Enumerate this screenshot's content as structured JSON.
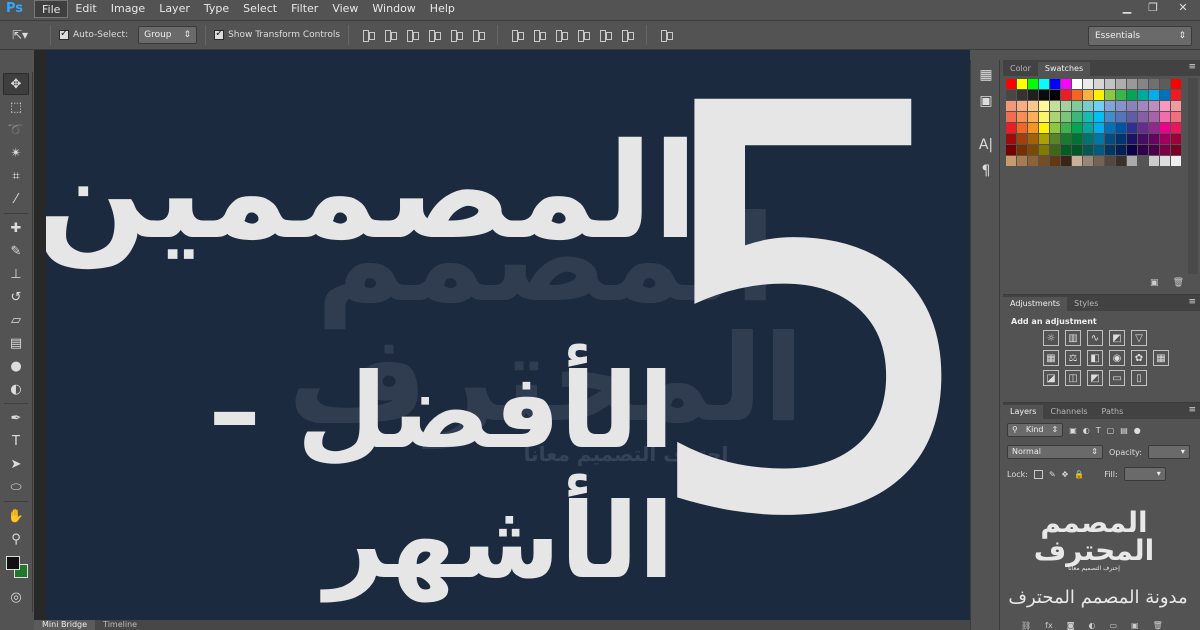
{
  "app": {
    "logo": "Ps"
  },
  "menu": [
    "File",
    "Edit",
    "Image",
    "Layer",
    "Type",
    "Select",
    "Filter",
    "View",
    "Window",
    "Help"
  ],
  "window_controls": {
    "minimize": "▁",
    "restore": "❐",
    "close": "✕"
  },
  "options_bar": {
    "auto_select_label": "Auto-Select:",
    "auto_select_value": "Group",
    "show_transform_label": "Show Transform Controls",
    "workspace": "Essentials"
  },
  "canvas": {
    "background": "#1b2a3f",
    "text_color": "#e6e6e6",
    "headline_1": "المصممين",
    "headline_2": "الأفضل – الأشهر",
    "big_number": "5",
    "watermark_logo": "المصمم المحترف",
    "watermark_tagline": "إحترف التصميم معانا"
  },
  "bottom_tabs": [
    "Mini Bridge",
    "Timeline"
  ],
  "panels": {
    "swatches": {
      "tabs": [
        "Color",
        "Swatches"
      ],
      "active": "Swatches"
    },
    "adjustments": {
      "tabs": [
        "Adjustments",
        "Styles"
      ],
      "title": "Add an adjustment"
    },
    "layers": {
      "tabs": [
        "Layers",
        "Channels",
        "Paths"
      ],
      "kind_label": "Kind",
      "blend_mode": "Normal",
      "opacity_label": "Opacity:",
      "lock_label": "Lock:",
      "fill_label": "Fill:",
      "brand_logo": "المصمم المحترف",
      "brand_tagline": "إحترف التصميم معانا",
      "brand_blog": "مدونة المصمم المحترف"
    }
  },
  "colors": {
    "swatches": [
      "#ff0000",
      "#ffff00",
      "#00ff00",
      "#00ffff",
      "#0000ff",
      "#ff00ff",
      "#ffffff",
      "#ebebeb",
      "#d6d6d6",
      "#c2c2c2",
      "#adadad",
      "#999999",
      "#858585",
      "#707070",
      "#5c5c5c",
      "#ff0000",
      "#474747",
      "#333333",
      "#1f1f1f",
      "#0a0a0a",
      "#000000",
      "#ee1d24",
      "#f26522",
      "#fbaf3f",
      "#fff200",
      "#8dc63f",
      "#39b54a",
      "#00a651",
      "#00a99d",
      "#00aeef",
      "#0072bc",
      "#ed1c24",
      "#f7977a",
      "#f9ad81",
      "#fdc68a",
      "#fff799",
      "#c4df9b",
      "#a3d39c",
      "#82ca9c",
      "#7accc8",
      "#6dcff6",
      "#7ea7d8",
      "#8493ca",
      "#8882be",
      "#a187be",
      "#bc8dbf",
      "#f49ac2",
      "#f6989d",
      "#f26c4f",
      "#f68e55",
      "#fbaf5c",
      "#fff467",
      "#acd372",
      "#7cc576",
      "#3bb878",
      "#1abbb4",
      "#00bff3",
      "#438ccb",
      "#5574b9",
      "#605ca8",
      "#855fa8",
      "#a763a8",
      "#f06ea9",
      "#f26d7d",
      "#ed1c24",
      "#f26522",
      "#f7941d",
      "#fff200",
      "#8dc63f",
      "#39b54a",
      "#00a651",
      "#00a99d",
      "#00aeef",
      "#0072bc",
      "#0054a6",
      "#2e3192",
      "#662d91",
      "#92278f",
      "#ec008c",
      "#ed145b",
      "#9e0b0f",
      "#a0410d",
      "#a36209",
      "#aba000",
      "#598527",
      "#1a7b30",
      "#007236",
      "#00746b",
      "#0076a3",
      "#004b80",
      "#003471",
      "#1b1464",
      "#440e62",
      "#630460",
      "#9e005d",
      "#9e0039",
      "#790000",
      "#7b2e00",
      "#7d4900",
      "#827b00",
      "#406618",
      "#005e20",
      "#005826",
      "#005952",
      "#005b7f",
      "#003663",
      "#002157",
      "#0d004c",
      "#32004b",
      "#4b0049",
      "#7b0046",
      "#7a0026",
      "#c69c6d",
      "#a67c52",
      "#8c6239",
      "#754c24",
      "#603913",
      "#3c2415",
      "#c7b299",
      "#998675",
      "#736357",
      "#534741",
      "#37302d",
      "#aaaaaa",
      "#555555",
      "#cccccc",
      "#dddddd",
      "#eeeeee"
    ],
    "fg": "#111111",
    "bg": "#1e7a2a"
  }
}
